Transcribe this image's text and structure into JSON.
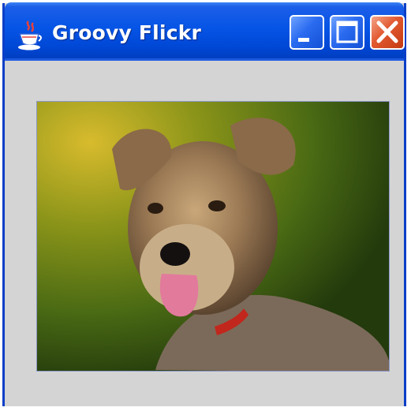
{
  "window": {
    "title": "Groovy Flickr",
    "app_icon": "java-coffee-cup-icon",
    "controls": {
      "minimize": "minimize-icon",
      "maximize": "maximize-icon",
      "close": "close-icon"
    }
  },
  "content": {
    "image": "dog-photo",
    "colors": {
      "titlebar": "#0655e6",
      "client_background": "#d4d4d4",
      "close_button": "#e2582f"
    }
  }
}
